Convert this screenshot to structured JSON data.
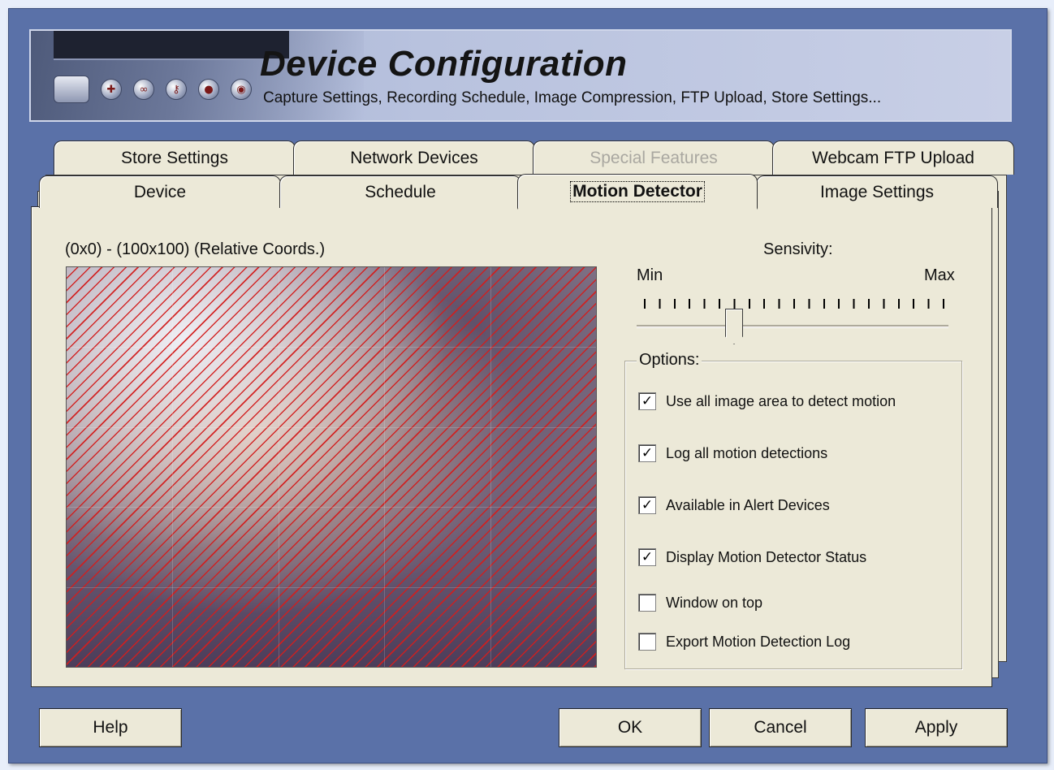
{
  "banner": {
    "title": "Device Configuration",
    "subtitle": "Capture Settings, Recording Schedule,  Image Compression, FTP Upload, Store Settings..."
  },
  "tabs_row1": [
    {
      "label": "Store Settings",
      "enabled": true
    },
    {
      "label": "Network Devices",
      "enabled": true
    },
    {
      "label": "Special Features",
      "enabled": false
    },
    {
      "label": "Webcam FTP Upload",
      "enabled": true
    }
  ],
  "tabs_row2": [
    {
      "label": "Device",
      "active": false
    },
    {
      "label": "Schedule",
      "active": false
    },
    {
      "label": "Motion Detector",
      "active": true
    },
    {
      "label": "Image Settings",
      "active": false
    }
  ],
  "motion": {
    "coords_label": "(0x0) - (100x100)  (Relative Coords.)",
    "sensitivity_label": "Sensivity:",
    "min_label": "Min",
    "max_label": "Max",
    "sensitivity_fraction": 0.3
  },
  "options": {
    "legend": "Options:",
    "items": [
      {
        "label": "Use all image area to detect motion",
        "checked": true
      },
      {
        "label": "Log all motion detections",
        "checked": true
      },
      {
        "label": "Available in Alert Devices",
        "checked": true
      },
      {
        "label": "Display Motion Detector Status",
        "checked": true
      },
      {
        "label": "Window on top",
        "checked": false
      },
      {
        "label": "Export Motion Detection Log",
        "checked": false
      }
    ]
  },
  "buttons": {
    "help": "Help",
    "ok": "OK",
    "cancel": "Cancel",
    "apply": "Apply"
  },
  "colors": {
    "window_bg": "#5a71a8",
    "panel_bg": "#ece9d8",
    "hatch": "#d21e1e"
  }
}
